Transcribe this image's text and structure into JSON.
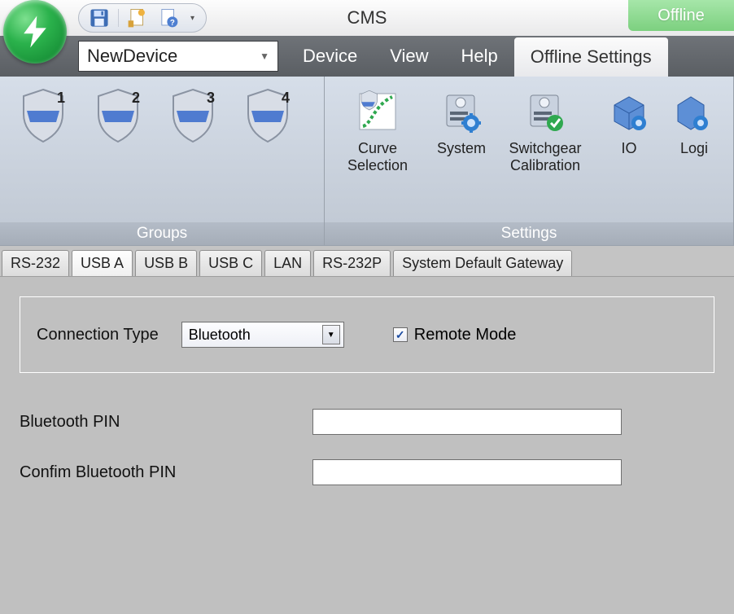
{
  "app": {
    "title": "CMS",
    "status": "Offline"
  },
  "qat": {
    "items": [
      "save",
      "sheet-color",
      "sheet-help"
    ]
  },
  "device_dropdown": {
    "value": "NewDevice"
  },
  "menu": {
    "items": [
      {
        "label": "Device",
        "active": false
      },
      {
        "label": "View",
        "active": false
      },
      {
        "label": "Help",
        "active": false
      },
      {
        "label": "Offline Settings",
        "active": true
      }
    ]
  },
  "ribbon": {
    "groups": {
      "label": "Groups",
      "shields": [
        {
          "num": "1"
        },
        {
          "num": "2"
        },
        {
          "num": "3"
        },
        {
          "num": "4"
        }
      ]
    },
    "settings": {
      "label": "Settings",
      "buttons": [
        {
          "key": "curve",
          "label": "Curve Selection"
        },
        {
          "key": "system",
          "label": "System"
        },
        {
          "key": "switchgear",
          "label": "Switchgear Calibration"
        },
        {
          "key": "io",
          "label": "IO"
        },
        {
          "key": "logic",
          "label": "Logi"
        }
      ]
    }
  },
  "conn_tabs": [
    {
      "label": "RS-232",
      "active": false
    },
    {
      "label": "USB A",
      "active": true
    },
    {
      "label": "USB B",
      "active": false
    },
    {
      "label": "USB C",
      "active": false
    },
    {
      "label": "LAN",
      "active": false
    },
    {
      "label": "RS-232P",
      "active": false
    },
    {
      "label": "System Default Gateway",
      "active": false
    }
  ],
  "panel": {
    "connection_type_label": "Connection Type",
    "connection_type_value": "Bluetooth",
    "remote_mode_label": "Remote Mode",
    "remote_mode_checked": true,
    "bluetooth_pin_label": "Bluetooth PIN",
    "bluetooth_pin_value": "",
    "confirm_pin_label": "Confim Bluetooth PIN",
    "confirm_pin_value": ""
  }
}
